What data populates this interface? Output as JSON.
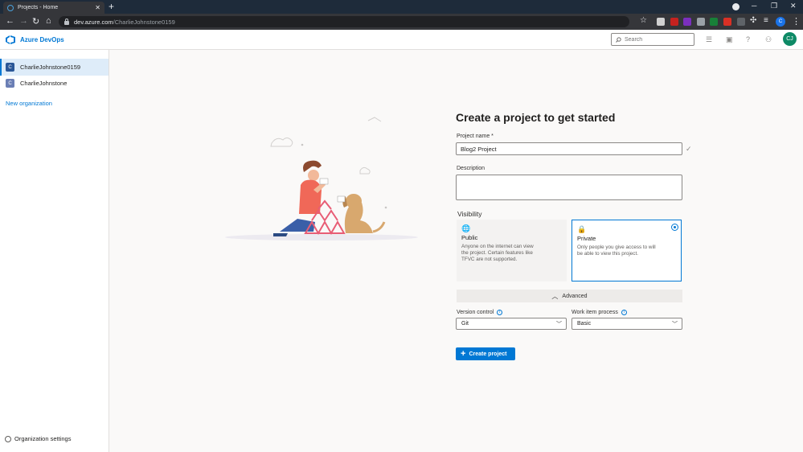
{
  "browser": {
    "tab_title": "Projects - Home",
    "url_host": "dev.azure.com",
    "url_path": "/CharlieJohnstone0159",
    "profile_initial": "C"
  },
  "header": {
    "brand": "Azure DevOps",
    "search_placeholder": "Search",
    "user_initials": "CJ"
  },
  "sidebar": {
    "orgs": [
      {
        "initial": "C",
        "label": "CharlieJohnstone0159",
        "color": "#2b5797"
      },
      {
        "initial": "C",
        "label": "CharlieJohnstone",
        "color": "#6b7fb5"
      }
    ],
    "new_org": "New organization",
    "settings": "Organization settings"
  },
  "form": {
    "title": "Create a project to get started",
    "project_name_label": "Project name *",
    "project_name_value": "Blog2 Project",
    "description_label": "Description",
    "description_value": "",
    "visibility_label": "Visibility",
    "public": {
      "title": "Public",
      "desc": "Anyone on the internet can view the project. Certain features like TFVC are not supported."
    },
    "private": {
      "title": "Private",
      "desc": "Only people you give access to will be able to view this project."
    },
    "advanced_label": "Advanced",
    "version_control_label": "Version control",
    "version_control_value": "Git",
    "work_item_label": "Work item process",
    "work_item_value": "Basic",
    "create_button": "Create project"
  },
  "colors": {
    "accent": "#0078d4",
    "avatar": "#0e8a66"
  }
}
